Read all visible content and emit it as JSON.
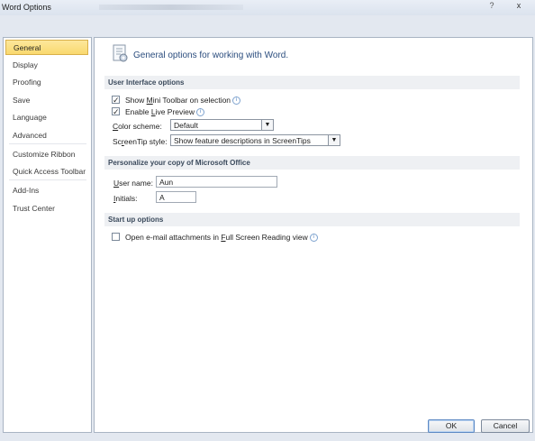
{
  "window": {
    "title": "Word Options",
    "help_label": "?",
    "close_label": "x"
  },
  "sidebar": {
    "items": [
      {
        "label": "General",
        "selected": true
      },
      {
        "label": "Display"
      },
      {
        "label": "Proofing"
      },
      {
        "label": "Save"
      },
      {
        "label": "Language"
      },
      {
        "label": "Advanced"
      },
      {
        "label": "Customize Ribbon"
      },
      {
        "label": "Quick Access Toolbar"
      },
      {
        "label": "Add-Ins"
      },
      {
        "label": "Trust Center"
      }
    ]
  },
  "header": {
    "text": "General options for working with Word."
  },
  "ui_options": {
    "section_title": "User Interface options",
    "mini_toolbar": {
      "pre": "Show ",
      "ul": "M",
      "post": "ini Toolbar on selection",
      "checked": true
    },
    "live_preview": {
      "pre": "Enable ",
      "ul": "L",
      "post": "ive Preview",
      "checked": true
    },
    "color_scheme": {
      "label_ul": "C",
      "label_rest": "olor scheme:",
      "value": "Default"
    },
    "screentip": {
      "label_pre": "Sc",
      "label_ul": "r",
      "label_post": "eenTip style:",
      "value": "Show feature descriptions in ScreenTips"
    }
  },
  "personalize": {
    "section_title": "Personalize your copy of Microsoft Office",
    "user_name": {
      "label_ul": "U",
      "label_rest": "ser name:",
      "value": "Aun"
    },
    "initials": {
      "label_ul": "I",
      "label_rest": "nitials:",
      "value": "A"
    }
  },
  "startup": {
    "section_title": "Start up options",
    "fullscreen": {
      "pre": "Open e-mail attachments in ",
      "ul": "F",
      "post": "ull Screen Reading view",
      "checked": false
    }
  },
  "footer": {
    "ok_label": "OK",
    "cancel_label": "Cancel"
  },
  "icons": {
    "info": "info-icon",
    "dropdown": "chevron-down-icon",
    "header": "options-document-icon"
  },
  "colors": {
    "accent_selected": "#f9d96e",
    "header_text": "#2b4d7e"
  }
}
